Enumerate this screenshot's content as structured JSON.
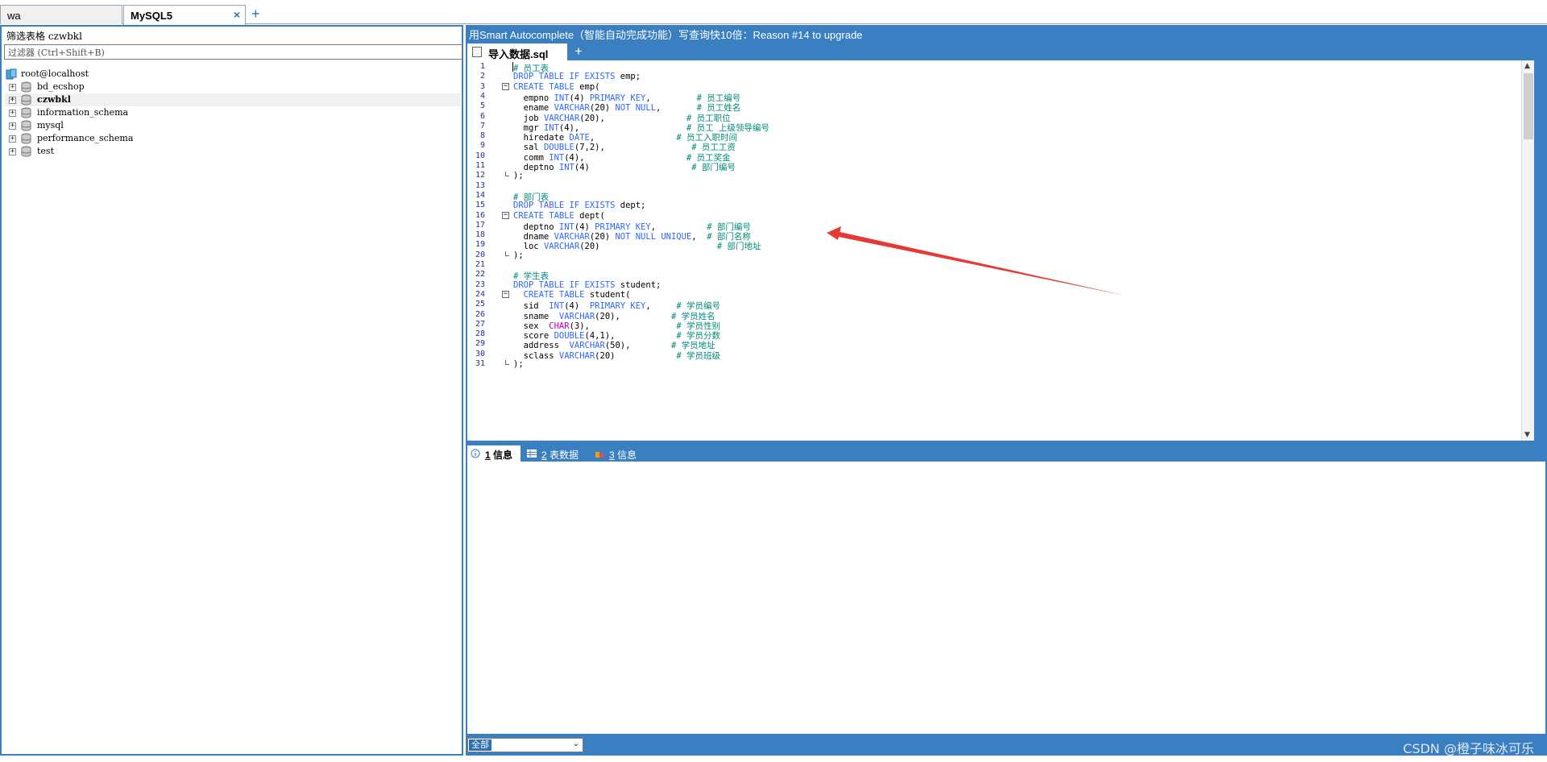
{
  "connection_tabs": [
    {
      "label": "wa",
      "active": false
    },
    {
      "label": "MySQL5",
      "active": true
    }
  ],
  "connection_tab_close": "×",
  "connection_tab_add": "+",
  "left": {
    "filter_title": "筛选表格 czwbkl",
    "filter_placeholder": "过滤器 (Ctrl+Shift+B)",
    "root": "root@localhost",
    "databases": [
      {
        "name": "bd_ecshop",
        "selected": false
      },
      {
        "name": "czwbkl",
        "selected": true
      },
      {
        "name": "information_schema",
        "selected": false
      },
      {
        "name": "mysql",
        "selected": false
      },
      {
        "name": "performance_schema",
        "selected": false
      },
      {
        "name": "test",
        "selected": false
      }
    ],
    "expander_glyph": "+"
  },
  "right": {
    "banner": "用Smart Autocomplete（智能自动完成功能）写查询快10倍：Reason #14 to upgrade",
    "query_tab": "导入数据.sql",
    "query_tab_add": "+",
    "result_tabs": [
      {
        "num": "1",
        "label": " 信息",
        "active": true
      },
      {
        "num": "2",
        "label": " 表数据",
        "active": false
      },
      {
        "num": "3",
        "label": " 信息",
        "active": false
      }
    ],
    "filter_select_value": "全部",
    "watermark": "CSDN @橙子味冰可乐"
  },
  "code_lines": [
    {
      "n": "1",
      "t": [
        [
          "cm",
          "# 员工表"
        ]
      ],
      "fold": null
    },
    {
      "n": "2",
      "t": [
        [
          "kw",
          "DROP TABLE IF EXISTS"
        ],
        [
          "",
          " emp;"
        ]
      ],
      "fold": null
    },
    {
      "n": "3",
      "t": [
        [
          "kw",
          "CREATE TABLE"
        ],
        [
          "",
          " emp("
        ]
      ],
      "fold": "start"
    },
    {
      "n": "4",
      "t": [
        [
          "",
          "  empno "
        ],
        [
          "kw",
          "INT"
        ],
        [
          "",
          "(4) "
        ],
        [
          "kw",
          "PRIMARY KEY"
        ],
        [
          "",
          ",         "
        ],
        [
          "cm",
          "# 员工编号"
        ]
      ],
      "fold": null
    },
    {
      "n": "5",
      "t": [
        [
          "",
          "  ename "
        ],
        [
          "kw",
          "VARCHAR"
        ],
        [
          "",
          "(20) "
        ],
        [
          "kw",
          "NOT NULL"
        ],
        [
          "",
          ",       "
        ],
        [
          "cm",
          "# 员工姓名"
        ]
      ],
      "fold": null
    },
    {
      "n": "6",
      "t": [
        [
          "",
          "  job "
        ],
        [
          "kw",
          "VARCHAR"
        ],
        [
          "",
          "(20),                "
        ],
        [
          "cm",
          "# 员工职位"
        ]
      ],
      "fold": null
    },
    {
      "n": "7",
      "t": [
        [
          "",
          "  mgr "
        ],
        [
          "kw",
          "INT"
        ],
        [
          "",
          "(4),                     "
        ],
        [
          "cm",
          "# 员工 上级领导编号"
        ]
      ],
      "fold": null
    },
    {
      "n": "8",
      "t": [
        [
          "",
          "  hiredate "
        ],
        [
          "kw",
          "DATE"
        ],
        [
          "",
          ",                "
        ],
        [
          "cm",
          "# 员工入职时间"
        ]
      ],
      "fold": null
    },
    {
      "n": "9",
      "t": [
        [
          "",
          "  sal "
        ],
        [
          "kw",
          "DOUBLE"
        ],
        [
          "",
          "(7,2),                 "
        ],
        [
          "cm",
          "# 员工工资"
        ]
      ],
      "fold": null
    },
    {
      "n": "10",
      "t": [
        [
          "",
          "  comm "
        ],
        [
          "kw",
          "INT"
        ],
        [
          "",
          "(4),                    "
        ],
        [
          "cm",
          "# 员工奖金"
        ]
      ],
      "fold": null
    },
    {
      "n": "11",
      "t": [
        [
          "",
          "  deptno "
        ],
        [
          "kw",
          "INT"
        ],
        [
          "",
          "(4)                    "
        ],
        [
          "cm",
          "# 部门编号"
        ]
      ],
      "fold": null
    },
    {
      "n": "12",
      "t": [
        [
          "",
          ");"
        ]
      ],
      "fold": "end"
    },
    {
      "n": "13",
      "t": [],
      "fold": null
    },
    {
      "n": "14",
      "t": [
        [
          "cm",
          "# 部门表"
        ]
      ],
      "fold": null
    },
    {
      "n": "15",
      "t": [
        [
          "kw",
          "DROP TABLE IF EXISTS"
        ],
        [
          "",
          " dept;"
        ]
      ],
      "fold": null
    },
    {
      "n": "16",
      "t": [
        [
          "kw",
          "CREATE TABLE"
        ],
        [
          "",
          " dept("
        ]
      ],
      "fold": "start"
    },
    {
      "n": "17",
      "t": [
        [
          "",
          "  deptno "
        ],
        [
          "kw",
          "INT"
        ],
        [
          "",
          "(4) "
        ],
        [
          "kw",
          "PRIMARY KEY"
        ],
        [
          "",
          ",          "
        ],
        [
          "cm",
          "# 部门编号"
        ]
      ],
      "fold": null
    },
    {
      "n": "18",
      "t": [
        [
          "",
          "  dname "
        ],
        [
          "kw",
          "VARCHAR"
        ],
        [
          "",
          "(20) "
        ],
        [
          "kw",
          "NOT NULL UNIQUE"
        ],
        [
          "",
          ",  "
        ],
        [
          "cm",
          "# 部门名称"
        ]
      ],
      "fold": null
    },
    {
      "n": "19",
      "t": [
        [
          "",
          "  loc "
        ],
        [
          "kw",
          "VARCHAR"
        ],
        [
          "",
          "(20)                       "
        ],
        [
          "cm",
          "# 部门地址"
        ]
      ],
      "fold": null
    },
    {
      "n": "20",
      "t": [
        [
          "",
          ");"
        ]
      ],
      "fold": "end"
    },
    {
      "n": "21",
      "t": [],
      "fold": null
    },
    {
      "n": "22",
      "t": [
        [
          "cm",
          "# 学生表"
        ]
      ],
      "fold": null
    },
    {
      "n": "23",
      "t": [
        [
          "kw",
          "DROP TABLE IF EXISTS"
        ],
        [
          "",
          " student;"
        ]
      ],
      "fold": null
    },
    {
      "n": "24",
      "t": [
        [
          "",
          "  "
        ],
        [
          "kw",
          "CREATE TABLE"
        ],
        [
          "",
          " student("
        ]
      ],
      "fold": "start"
    },
    {
      "n": "25",
      "t": [
        [
          "",
          "  sid  "
        ],
        [
          "kw",
          "INT"
        ],
        [
          "",
          "(4)  "
        ],
        [
          "kw",
          "PRIMARY KEY"
        ],
        [
          "",
          ",     "
        ],
        [
          "cm",
          "# 学员编号"
        ]
      ],
      "fold": null
    },
    {
      "n": "26",
      "t": [
        [
          "",
          "  sname  "
        ],
        [
          "kw",
          "VARCHAR"
        ],
        [
          "",
          "(20),          "
        ],
        [
          "cm",
          "# 学员姓名"
        ]
      ],
      "fold": null
    },
    {
      "n": "27",
      "t": [
        [
          "",
          "  sex  "
        ],
        [
          "pk",
          "CHAR"
        ],
        [
          "",
          "(3),                 "
        ],
        [
          "cm",
          "# 学员性别"
        ]
      ],
      "fold": null
    },
    {
      "n": "28",
      "t": [
        [
          "",
          "  score "
        ],
        [
          "kw",
          "DOUBLE"
        ],
        [
          "",
          "(4,1),            "
        ],
        [
          "cm",
          "# 学员分数"
        ]
      ],
      "fold": null
    },
    {
      "n": "29",
      "t": [
        [
          "",
          "  address  "
        ],
        [
          "kw",
          "VARCHAR"
        ],
        [
          "",
          "(50),        "
        ],
        [
          "cm",
          "# 学员地址"
        ]
      ],
      "fold": null
    },
    {
      "n": "30",
      "t": [
        [
          "",
          "  sclass "
        ],
        [
          "kw",
          "VARCHAR"
        ],
        [
          "",
          "(20)            "
        ],
        [
          "cm",
          "# 学员班级"
        ]
      ],
      "fold": null
    },
    {
      "n": "31",
      "t": [
        [
          "",
          ");"
        ]
      ],
      "fold": "end"
    }
  ],
  "colors": {
    "accent": "#3a7fc1",
    "keyword": "#2f66ff",
    "comment": "#00897b",
    "annotation_arrow": "#e53935"
  },
  "icons": {
    "close": "close-icon",
    "add": "plus-icon",
    "database": "database-icon",
    "server": "server-icon",
    "info": "info-icon",
    "grid": "table-grid-icon",
    "document": "sql-file-icon"
  }
}
